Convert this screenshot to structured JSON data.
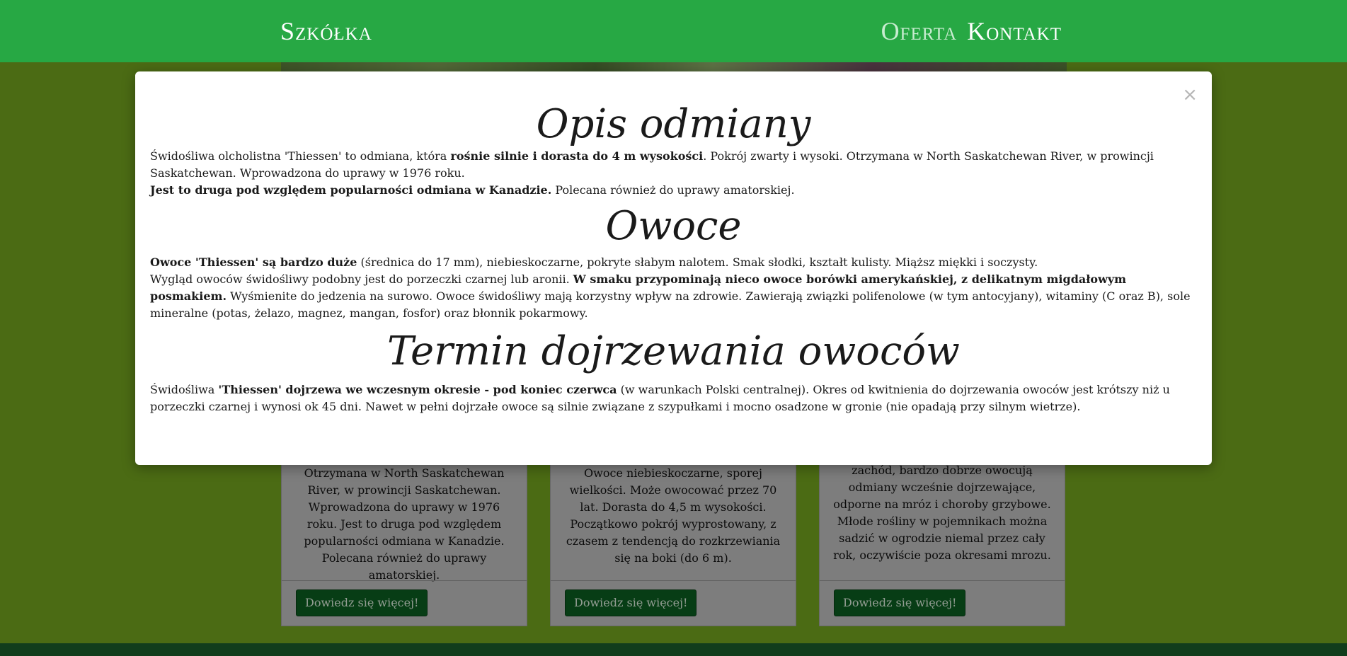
{
  "navbar": {
    "brand": "Szkółka",
    "links": [
      "Oferta",
      "Kontakt"
    ]
  },
  "cards": [
    {
      "text": "Otrzymana w North Saskatchewan River, w prowincji Saskatchewan. Wprowadzona do uprawy w 1976 roku. Jest to druga pod względem popularności odmiana w Kanadzie. Polecana również do uprawy amatorskiej.",
      "button": "Dowiedz się więcej!"
    },
    {
      "text": "Owoce niebieskoczarne, sporej wielkości. Może owocować przez 70 lat. Dorasta do 4,5 m wysokości. Początkowo pokrój wyprostowany, z czasem z tendencją do rozkrzewiania się na boki (do 6 m).",
      "button": "Dowiedz się więcej!"
    },
    {
      "text": "zachód, bardzo dobrze owocują odmiany wcześnie dojrzewające, odporne na mróz i choroby grzybowe. Młode rośliny w pojemnikach można sadzić w ogrodzie niemal przez cały rok, oczywiście poza okresami mrozu.",
      "button": "Dowiedz się więcej!"
    }
  ],
  "modal": {
    "close": "×",
    "heading1": "Opis odmiany",
    "p1_a": "Świdośliwa olcholistna 'Thiessen' to odmiana, która ",
    "p1_b": "rośnie silnie i dorasta do 4 m wysokości",
    "p1_c": ". Pokrój zwarty i wysoki. Otrzymana w North Saskatchewan River, w prowincji Saskatchewan. Wprowadzona do uprawy w 1976 roku.",
    "p2_b": "Jest to druga pod względem popularności odmiana w Kanadzie.",
    "p2_c": " Polecana również do uprawy amatorskiej.",
    "heading2": "Owoce",
    "p3_b": "Owoce 'Thiessen' są bardzo duże",
    "p3_c": " (średnica do 17 mm), niebieskoczarne, pokryte słabym nalotem. Smak słodki, kształt kulisty. Miąższ miękki i soczysty.",
    "p4_a": "Wygląd owoców świdośliwy podobny jest do porzeczki czarnej lub aronii. ",
    "p4_b": "W smaku przypominają nieco owoce borówki amerykańskiej, z delikatnym migdałowym posmakiem.",
    "p4_c": " Wyśmienite do jedzenia na surowo. Owoce świdośliwy mają korzystny wpływ na zdrowie. Zawierają związki polifenolowe (w tym antocyjany), witaminy (C oraz B), sole mineralne (potas, żelazo, magnez, mangan, fosfor) oraz błonnik pokarmowy.",
    "heading3": "Termin dojrzewania owoców",
    "p5_a": "Świdośliwa ",
    "p5_b": "'Thiessen' dojrzewa we wczesnym okresie - pod koniec czerwca",
    "p5_c": " (w warunkach Polski centralnej). Okres od kwitnienia do dojrzewania owoców jest krótszy niż u porzeczki czarnej i wynosi ok 45 dni. Nawet w pełni dojrzałe owoce są silnie związane z szypułkami i mocno osadzone w gronie (nie opadają przy silnym wietrze)."
  }
}
